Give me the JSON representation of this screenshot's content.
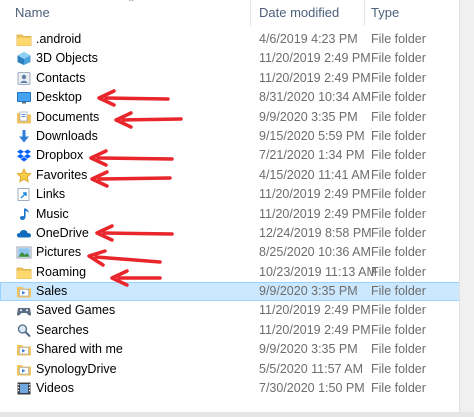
{
  "header": {
    "name_label": "Name",
    "date_label": "Date modified",
    "type_label": "Type"
  },
  "rows": [
    {
      "name": "android_label",
      "label": ".android",
      "date": "4/6/2019 4:23 PM",
      "type": "File folder",
      "icon": "folder-icon"
    },
    {
      "name": "3d",
      "label": "3D Objects",
      "date": "11/20/2019 2:49 PM",
      "type": "File folder",
      "icon": "3d-objects-icon"
    },
    {
      "name": "contacts",
      "label": "Contacts",
      "date": "11/20/2019 2:49 PM",
      "type": "File folder",
      "icon": "contacts-icon"
    },
    {
      "name": "desktop",
      "label": "Desktop",
      "date": "8/31/2020 10:34 AM",
      "type": "File folder",
      "icon": "desktop-icon"
    },
    {
      "name": "documents",
      "label": "Documents",
      "date": "9/9/2020 3:35 PM",
      "type": "File folder",
      "icon": "documents-icon"
    },
    {
      "name": "downloads",
      "label": "Downloads",
      "date": "9/15/2020 5:59 PM",
      "type": "File folder",
      "icon": "downloads-icon"
    },
    {
      "name": "dropbox",
      "label": "Dropbox",
      "date": "7/21/2020 1:34 PM",
      "type": "File folder",
      "icon": "dropbox-icon"
    },
    {
      "name": "favorites",
      "label": "Favorites",
      "date": "4/15/2020 11:41 AM",
      "type": "File folder",
      "icon": "favorites-star-icon"
    },
    {
      "name": "links",
      "label": "Links",
      "date": "11/20/2019 2:49 PM",
      "type": "File folder",
      "icon": "links-icon"
    },
    {
      "name": "music",
      "label": "Music",
      "date": "11/20/2019 2:49 PM",
      "type": "File folder",
      "icon": "music-icon"
    },
    {
      "name": "onedrive",
      "label": "OneDrive",
      "date": "12/24/2019 8:58 PM",
      "type": "File folder",
      "icon": "onedrive-cloud-icon"
    },
    {
      "name": "pictures",
      "label": "Pictures",
      "date": "8/25/2020 10:36 AM",
      "type": "File folder",
      "icon": "pictures-icon"
    },
    {
      "name": "roaming",
      "label": "Roaming",
      "date": "10/23/2019 11:13 AM",
      "type": "File folder",
      "icon": "folder-icon"
    },
    {
      "name": "sales",
      "label": "Sales",
      "date": "9/9/2020 3:35 PM",
      "type": "File folder",
      "icon": "shared-folder-icon",
      "selected": true
    },
    {
      "name": "savedgames",
      "label": "Saved Games",
      "date": "11/20/2019 2:49 PM",
      "type": "File folder",
      "icon": "saved-games-icon"
    },
    {
      "name": "searches",
      "label": "Searches",
      "date": "11/20/2019 2:49 PM",
      "type": "File folder",
      "icon": "searches-icon"
    },
    {
      "name": "sharedwithme",
      "label": "Shared with me",
      "date": "9/9/2020 3:35 PM",
      "type": "File folder",
      "icon": "shared-folder-icon"
    },
    {
      "name": "synologydrive",
      "label": "SynologyDrive",
      "date": "5/5/2020 11:57 AM",
      "type": "File folder",
      "icon": "shared-folder-icon"
    },
    {
      "name": "videos",
      "label": "Videos",
      "date": "7/30/2020 1:50 PM",
      "type": "File folder",
      "icon": "videos-icon"
    }
  ],
  "colors": {
    "selection_fill": "#cce8ff",
    "selection_border": "#99d1ff",
    "annotation_arrow": "#e8262b",
    "header_text": "#4c607a",
    "secondary_text": "#6d6d6d"
  }
}
